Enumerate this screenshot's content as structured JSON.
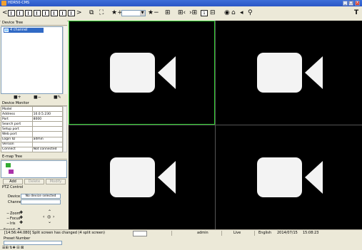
{
  "window": {
    "title": "HDR50-CMS",
    "buttons": [
      "_",
      "□",
      "X"
    ]
  },
  "toolbar": {
    "prev_label": "<",
    "next_label": ">",
    "stream_value": "",
    "page_value": "1"
  },
  "left_panel": {
    "device_tree": {
      "header": "Device Tree",
      "node_label": "4 channel",
      "buttons": [
        "■+",
        "■−",
        "■✎"
      ]
    },
    "device_monitor": {
      "header": "Device Monitor",
      "rows": [
        {
          "key": "Model",
          "value": ""
        },
        {
          "key": "Address",
          "value": "10.0.5.230"
        },
        {
          "key": "Port",
          "value": "8000"
        },
        {
          "key": "Search port",
          "value": ""
        },
        {
          "key": "Setup port",
          "value": ""
        },
        {
          "key": "Web port",
          "value": ""
        },
        {
          "key": "Login ID",
          "value": "admin"
        },
        {
          "key": "Version",
          "value": ""
        },
        {
          "key": "Connect",
          "value": "Not connected"
        }
      ]
    },
    "emap": {
      "header": "E-map Tree",
      "buttons": [
        "Add",
        "Delete",
        "Modify"
      ]
    },
    "ptz": {
      "header": "PTZ Control",
      "device_label": "Device",
      "device_value": "No device selected",
      "channel_label": "Channel",
      "zoom_label": "Zoom",
      "focus_label": "Focus",
      "iris_label": "Iris",
      "speed_label": "Speed",
      "preset_label": "Preset Number"
    }
  },
  "video_grid": {
    "cells": [
      {
        "id": "cell-1",
        "selected": true
      },
      {
        "id": "cell-2",
        "selected": false
      },
      {
        "id": "cell-3",
        "selected": false
      },
      {
        "id": "cell-4",
        "selected": false
      }
    ],
    "colors": {
      "selected_border": "#2ecc2e",
      "background": "#000000",
      "placeholder": "#f3f3f3"
    }
  },
  "status_bar": {
    "message": "[14:56:44.080] Split screen has changed (4 split screen)",
    "user": "admin",
    "mode": "Live",
    "language": "English",
    "date": "2014/07/15",
    "time": "15:08:23"
  },
  "icons": [
    "app-icon",
    "layout-icon",
    "record-icon",
    "zoom-icon",
    "speaker-icon",
    "settings-icon"
  ]
}
